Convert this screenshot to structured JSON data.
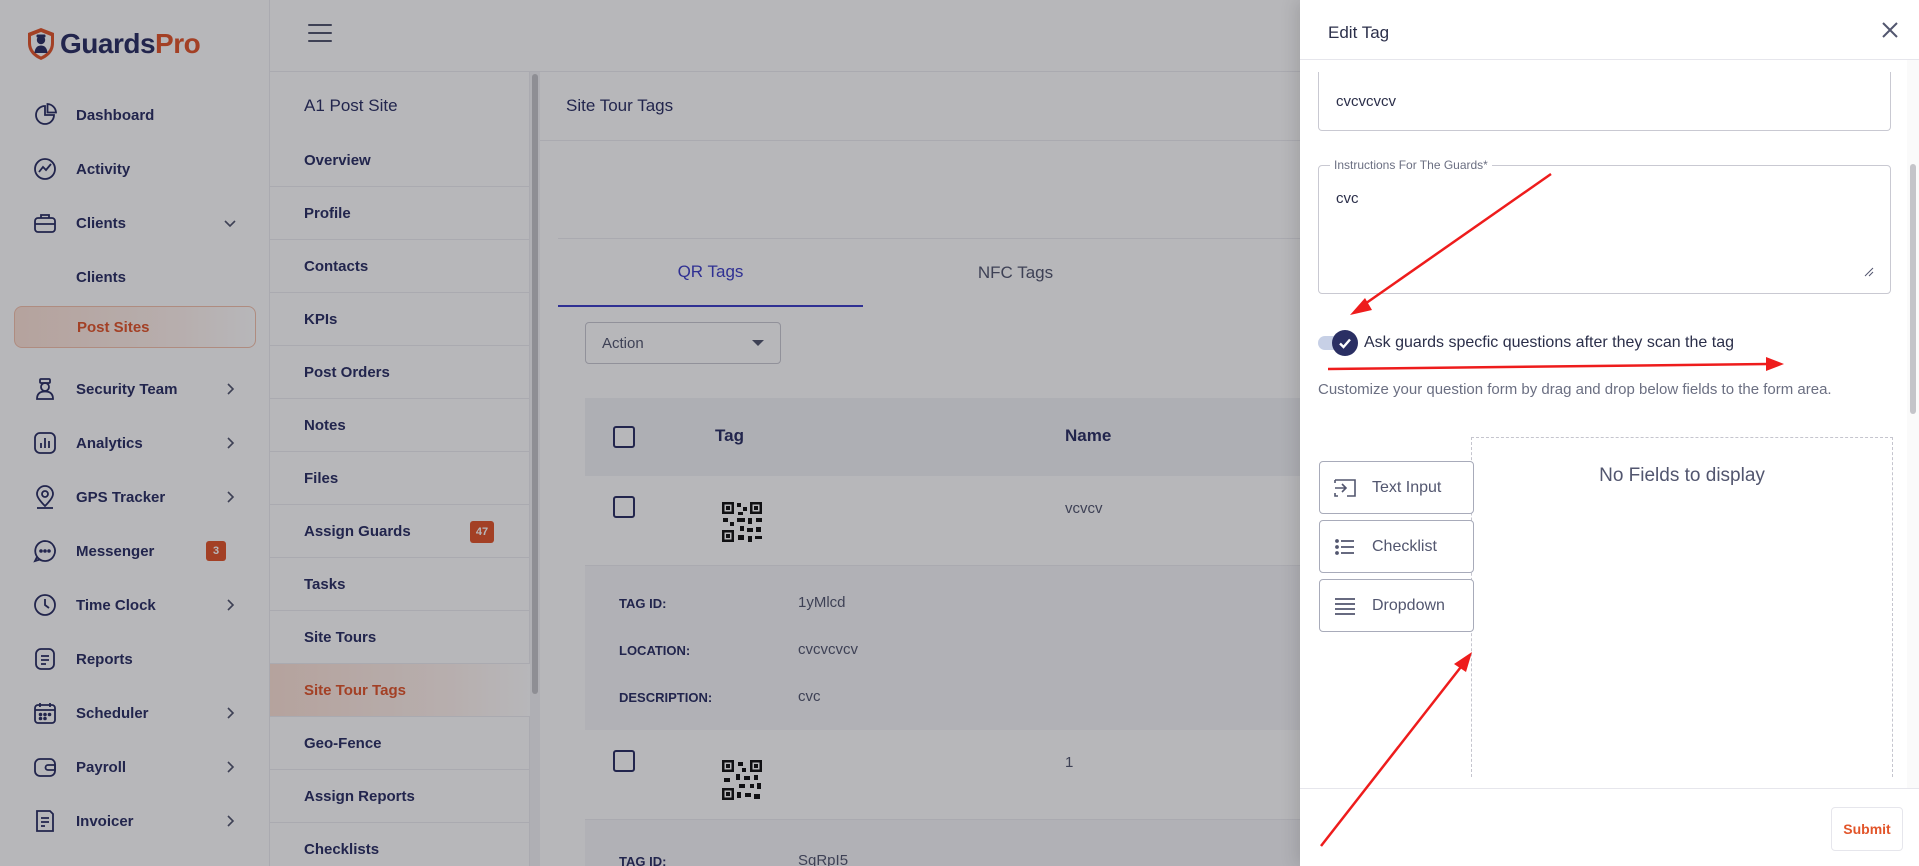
{
  "brand": {
    "name_part1": "Guards",
    "name_part2": "Pro"
  },
  "sidebar": {
    "items": [
      {
        "label": "Dashboard",
        "icon": "pie-chart-icon"
      },
      {
        "label": "Activity",
        "icon": "activity-chart-icon"
      },
      {
        "label": "Clients",
        "icon": "briefcase-icon",
        "expanded": true
      },
      {
        "label": "Security Team",
        "icon": "guard-icon"
      },
      {
        "label": "Analytics",
        "icon": "bar-chart-icon"
      },
      {
        "label": "GPS Tracker",
        "icon": "map-pin-icon"
      },
      {
        "label": "Messenger",
        "icon": "chat-bubble-icon",
        "badge": "3"
      },
      {
        "label": "Time Clock",
        "icon": "clock-icon"
      },
      {
        "label": "Reports",
        "icon": "document-icon"
      },
      {
        "label": "Scheduler",
        "icon": "calendar-icon"
      },
      {
        "label": "Payroll",
        "icon": "wallet-icon"
      },
      {
        "label": "Invoicer",
        "icon": "invoice-icon"
      }
    ],
    "sub_items": [
      {
        "label": "Clients"
      },
      {
        "label": "Post Sites",
        "active": true
      }
    ]
  },
  "subnav": {
    "title": "A1 Post Site",
    "items": [
      {
        "label": "Overview"
      },
      {
        "label": "Profile"
      },
      {
        "label": "Contacts"
      },
      {
        "label": "KPIs"
      },
      {
        "label": "Post Orders"
      },
      {
        "label": "Notes"
      },
      {
        "label": "Files"
      },
      {
        "label": "Assign Guards",
        "badge": "47"
      },
      {
        "label": "Tasks"
      },
      {
        "label": "Site Tours"
      },
      {
        "label": "Site Tour Tags",
        "active": true
      },
      {
        "label": "Geo-Fence"
      },
      {
        "label": "Assign Reports"
      },
      {
        "label": "Checklists"
      }
    ]
  },
  "main": {
    "title": "Site Tour Tags",
    "tabs": [
      {
        "label": "QR Tags",
        "active": true
      },
      {
        "label": "NFC Tags"
      }
    ],
    "action_select": "Action",
    "table": {
      "columns": [
        "Tag",
        "Name"
      ],
      "rows": [
        {
          "name": "vcvcv",
          "details": [
            {
              "label": "TAG ID:",
              "value": "1yMlcd"
            },
            {
              "label": "LOCATION:",
              "value": "cvcvcvcv"
            },
            {
              "label": "DESCRIPTION:",
              "value": "cvc"
            }
          ]
        },
        {
          "name": "1",
          "details": [
            {
              "label": "TAG ID:",
              "value": "SqRpI5"
            }
          ]
        }
      ]
    }
  },
  "drawer": {
    "title": "Edit Tag",
    "location_value": "cvcvcvcv",
    "instructions_label": "Instructions For The Guards*",
    "instructions_value": "cvc",
    "toggle_label": "Ask guards specfic questions after they scan the tag",
    "toggle_on": true,
    "hint": "Customize your question form by drag and drop below fields to the form area.",
    "palette": [
      {
        "label": "Text Input",
        "icon": "text-input-icon"
      },
      {
        "label": "Checklist",
        "icon": "checklist-icon"
      },
      {
        "label": "Dropdown",
        "icon": "dropdown-lines-icon"
      }
    ],
    "empty_text": "No Fields to display",
    "submit_label": "Submit"
  },
  "colors": {
    "brand_navy": "#2a2f63",
    "brand_orange": "#e2552a",
    "tab_active": "#3d3ec7",
    "annotation_red": "#ee1c1c"
  }
}
